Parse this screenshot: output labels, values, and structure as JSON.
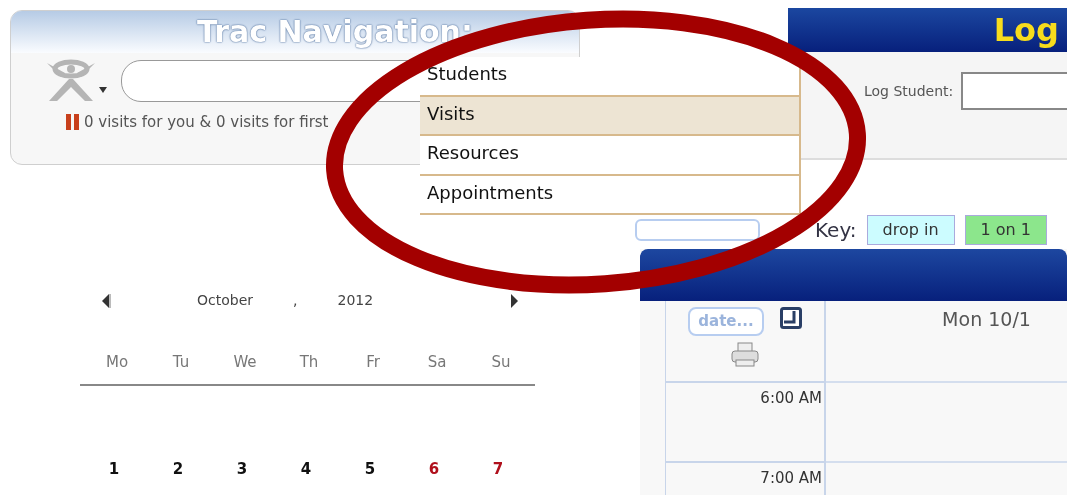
{
  "navigation_panel": {
    "title": "Trac Navigation:",
    "status": "0 visits for you & 0 visits for first"
  },
  "search_menu": {
    "items": [
      {
        "label": "Students",
        "selected": false
      },
      {
        "label": "Visits",
        "selected": true
      },
      {
        "label": "Resources",
        "selected": false
      },
      {
        "label": "Appointments",
        "selected": false
      }
    ]
  },
  "calendar": {
    "month": "October",
    "separator": ",",
    "year": "2012",
    "weekdays": [
      "Mo",
      "Tu",
      "We",
      "Th",
      "Fr",
      "Sa",
      "Su"
    ],
    "dates": [
      {
        "text": "1",
        "weekend": false
      },
      {
        "text": "2",
        "weekend": false
      },
      {
        "text": "3",
        "weekend": false
      },
      {
        "text": "4",
        "weekend": false
      },
      {
        "text": "5",
        "weekend": false
      },
      {
        "text": "6",
        "weekend": true
      },
      {
        "text": "7",
        "weekend": true
      }
    ]
  },
  "log_panel": {
    "title": "Log",
    "student_label": "Log Student:"
  },
  "key": {
    "label": "Key:",
    "items": [
      {
        "label": "drop in",
        "color": "#ccfcff"
      },
      {
        "label": "1 on 1",
        "color": "#8ce68c"
      }
    ]
  },
  "schedule": {
    "date_button": "date...",
    "day_header": "Mon 10/1",
    "times": [
      "6:00 AM",
      "7:00 AM"
    ]
  }
}
